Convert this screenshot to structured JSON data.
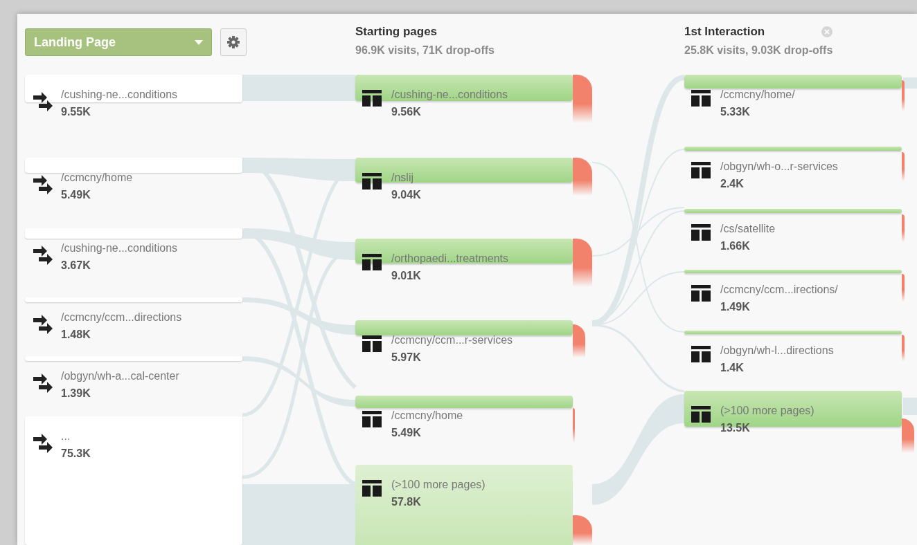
{
  "dimension_selector": {
    "label": "Landing Page"
  },
  "landing_pages": [
    {
      "label": "/cushing-ne...conditions",
      "value": "9.55K"
    },
    {
      "label": "/ccmcny/home",
      "value": "5.49K"
    },
    {
      "label": "/cushing-ne...conditions",
      "value": "3.67K"
    },
    {
      "label": "/ccmcny/ccm...directions",
      "value": "1.48K"
    },
    {
      "label": "/obgyn/wh-a...cal-center",
      "value": "1.39K"
    },
    {
      "label": "...",
      "value": "75.3K"
    }
  ],
  "columns": [
    {
      "title": "Starting pages",
      "summary": "96.9K visits, 71K drop-offs",
      "closable": false,
      "nodes": [
        {
          "label": "/cushing-ne...conditions",
          "value": "9.56K"
        },
        {
          "label": "/nslij",
          "value": "9.04K"
        },
        {
          "label": "/orthopaedi...treatments",
          "value": "9.01K"
        },
        {
          "label": "/ccmcny/ccm...r-services",
          "value": "5.97K"
        },
        {
          "label": "/ccmcny/home",
          "value": "5.49K"
        },
        {
          "label": "(>100 more pages)",
          "value": "57.8K"
        }
      ]
    },
    {
      "title": "1st Interaction",
      "summary": "25.8K visits, 9.03K drop-offs",
      "closable": true,
      "nodes": [
        {
          "label": "/ccmcny/home/",
          "value": "5.33K"
        },
        {
          "label": "/obgyn/wh-o...r-services",
          "value": "2.4K"
        },
        {
          "label": "/cs/satellite",
          "value": "1.66K"
        },
        {
          "label": "/ccmcny/ccm...irections/",
          "value": "1.49K"
        },
        {
          "label": "/obgyn/wh-l...directions",
          "value": "1.4K"
        },
        {
          "label": "(>100 more pages)",
          "value": "13.5K"
        }
      ]
    }
  ]
}
